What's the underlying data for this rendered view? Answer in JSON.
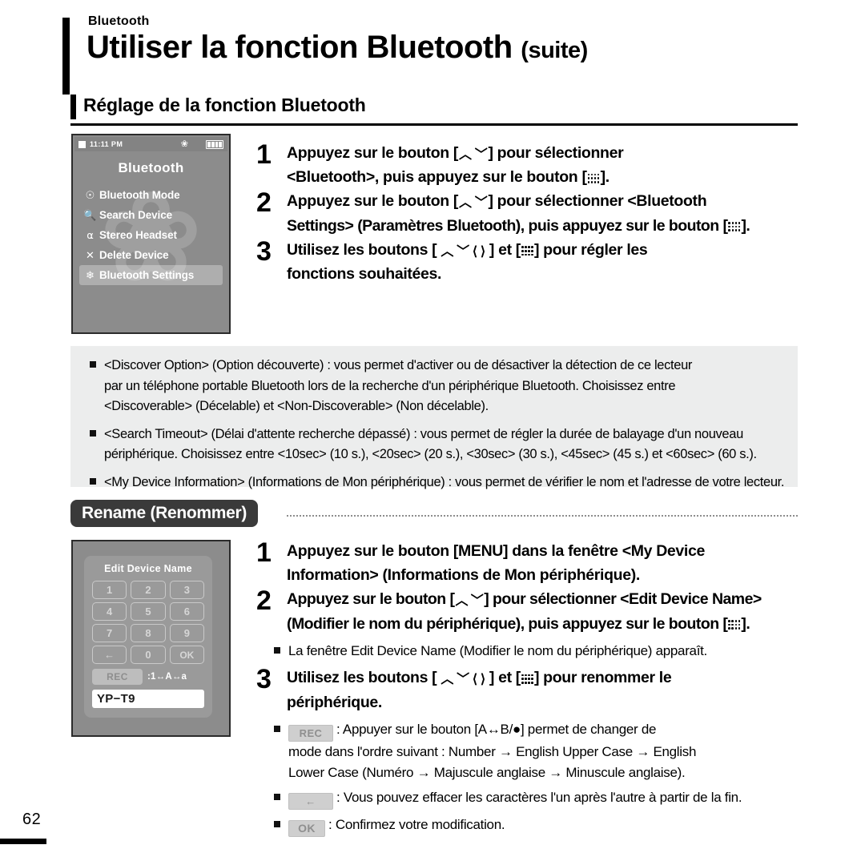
{
  "header": {
    "kicker": "Bluetooth",
    "title": "Utiliser la fonction Bluetooth",
    "title_suffix": "(suite)",
    "subhead": "Réglage de la fonction Bluetooth"
  },
  "device_bluetooth": {
    "status": {
      "time": "11:11 PM",
      "bluetooth_icon": "bluetooth-icon",
      "battery_icon": "battery-icon"
    },
    "title": "Bluetooth",
    "menu": [
      {
        "icon": "bluetooth-mode-icon",
        "glyph": "✪",
        "label": "Bluetooth Mode",
        "selected": false
      },
      {
        "icon": "search-icon",
        "glyph": "⌕",
        "label": "Search Device",
        "selected": false
      },
      {
        "icon": "headphones-icon",
        "glyph": "∩",
        "label": "Stereo Headset",
        "selected": false
      },
      {
        "icon": "delete-icon",
        "glyph": "✕",
        "label": "Delete Device",
        "selected": false
      },
      {
        "icon": "gear-icon",
        "glyph": "✸",
        "label": "Bluetooth Settings",
        "selected": true
      }
    ]
  },
  "steps_settings": [
    {
      "num": "1",
      "lines": [
        {
          "pre": "Appuyez sur le bouton [",
          "glyph": "updown",
          "post": "] pour sélectionner"
        },
        {
          "pre": "<Bluetooth>, puis appuyez sur le bouton [",
          "glyph": "dotpad",
          "post": "]."
        }
      ]
    },
    {
      "num": "2",
      "lines": [
        {
          "pre": "Appuyez sur le bouton [",
          "glyph": "updown",
          "post": "] pour sélectionner <Bluetooth"
        },
        {
          "pre": "Settings> (Paramètres Bluetooth), puis appuyez sur le bouton [",
          "glyph": "dotpad",
          "post": "]."
        }
      ]
    },
    {
      "num": "3",
      "lines": [
        {
          "pre": "Utilisez les boutons [",
          "glyph": "updownleftright",
          "post": "] et [",
          "glyph2": "dotpad",
          "post2": "] pour régler les"
        },
        {
          "pre": "fonctions souhaitées.",
          "glyph": "",
          "post": ""
        }
      ]
    }
  ],
  "infobox": [
    {
      "lines": [
        "<Discover Option> (Option découverte) : vous permet d'activer ou de désactiver la détection de ce lecteur",
        "par un téléphone portable Bluetooth lors de la recherche d'un périphérique Bluetooth. Choisissez entre",
        "<Discoverable> (Décelable) et <Non-Discoverable> (Non décelable)."
      ]
    },
    {
      "lines": [
        "<Search Timeout> (Délai d'attente recherche dépassé) : vous permet de régler la durée de balayage d'un nouveau",
        "périphérique. Choisissez entre <10sec> (10 s.), <20sec> (20 s.), <30sec> (30 s.), <45sec> (45 s.) et <60sec> (60 s.)."
      ]
    },
    {
      "lines": [
        "<My Device Information> (Informations de Mon périphérique) : vous permet de vérifier le nom et l'adresse de votre lecteur."
      ]
    }
  ],
  "rename_badge": "Rename (Renommer)",
  "device_keypad": {
    "title": "Edit Device Name",
    "keys": [
      "1",
      "2",
      "3",
      "4",
      "5",
      "6",
      "7",
      "8",
      "9"
    ],
    "bottom_keys": [
      "←",
      "0",
      "OK"
    ],
    "rec_label": "REC",
    "rec_legend": ":1↔A↔a",
    "name_value": "YP−T9"
  },
  "steps_rename": [
    {
      "num": "1",
      "lines": [
        {
          "pre": "Appuyez sur le bouton [MENU] dans la fenêtre <My Device",
          "glyph": "",
          "post": ""
        },
        {
          "pre": "Information> (Informations de Mon périphérique).",
          "glyph": "",
          "post": ""
        }
      ]
    },
    {
      "num": "2",
      "lines": [
        {
          "pre": "Appuyez sur le bouton [",
          "glyph": "updown",
          "post": "] pour sélectionner <Edit Device Name>"
        },
        {
          "pre": "(Modifier le nom du périphérique), puis appuyez sur le bouton [",
          "glyph": "dotpad",
          "post": "]."
        }
      ]
    }
  ],
  "rename_note_1": "La fenêtre Edit Device Name (Modifier le nom du périphérique) apparaît.",
  "step3_rename": {
    "num": "3",
    "lines": [
      {
        "pre": "Utilisez les boutons [",
        "glyph": "updownleftright",
        "post": "] et [",
        "glyph2": "dotpad",
        "post2": "] pour renommer le"
      },
      {
        "pre": "périphérique.",
        "glyph": "",
        "post": ""
      }
    ]
  },
  "key_notes": [
    {
      "key": "REC",
      "lines": [
        ": Appuyer sur le bouton [A↔B/●] permet de changer de",
        "mode dans l'ordre suivant : Number → English Upper Case → English",
        "Lower Case (Numéro → Majuscule anglaise → Minuscule anglaise)."
      ]
    },
    {
      "key": "←",
      "lines": [
        ": Vous pouvez effacer les caractères l'un après l'autre à partir de la fin."
      ]
    },
    {
      "key": "OK",
      "lines": [
        ": Confirmez votre modification."
      ]
    }
  ],
  "page_number": "62"
}
